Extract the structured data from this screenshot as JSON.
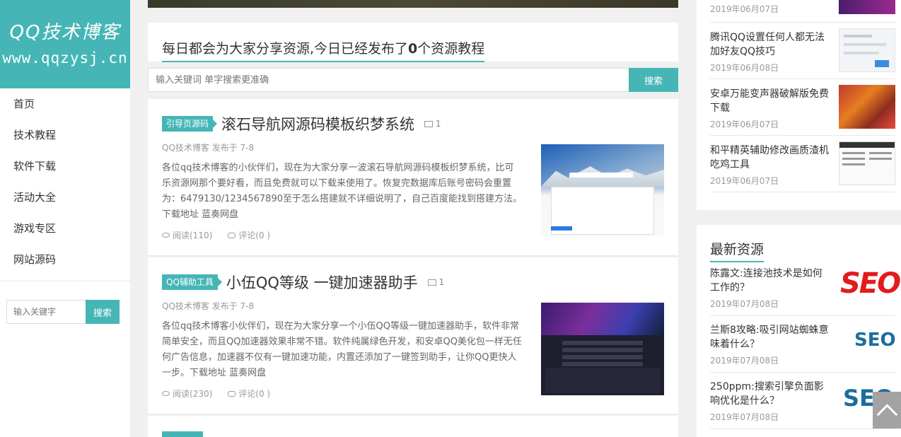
{
  "logo": {
    "title": "QQ技术博客",
    "url": "www.qqzysj.cn"
  },
  "nav": [
    "首页",
    "技术教程",
    "软件下载",
    "活动大全",
    "游戏专区",
    "网站源码"
  ],
  "side_search": {
    "placeholder": "输入关键字",
    "button": "搜索"
  },
  "announce": {
    "prefix": "每日都会为大家分享资源,今日已经发布了",
    "count": "0",
    "suffix": "个资源教程"
  },
  "main_search": {
    "placeholder": "输入关键词 单字搜索更准确",
    "button": "搜索"
  },
  "posts": [
    {
      "category": "引导页源码",
      "title": "滚石导航网源码模板织梦系统",
      "pics": "1",
      "meta": "QQ技术博客 发布于 7-8",
      "excerpt": "各位qq技术博客的小伙伴们，现在为大家分享一波滚石导航网源码模板织梦系统，比可乐资源网那个要好看，而且免费就可以下载来使用了。恢复完数据库后账号密码会重置为：6479130/1234567890至于怎么搭建就不详细说明了，自己百度能找到搭建方法。下载地址 蓝奏网盘",
      "views": "阅读(110)",
      "comments": "评论(0 )"
    },
    {
      "category": "QQ辅助工具",
      "title": "小伍QQ等级 一键加速器助手",
      "pics": "1",
      "meta": "QQ技术博客 发布于 7-8",
      "excerpt": "各位qq技术博客小伙伴们，现在为大家分享一个小伍QQ等级一键加速器助手，软件非常简单安全，而且QQ加速器效果非常不错。软件纯属绿色开发，和安卓QQ美化包一样无任何广告信息，加速器不仅有一键加速功能，内置还添加了一键签到助手，让你QQ更快人一步。下载地址 蓝奏网盘",
      "views": "阅读(230)",
      "comments": "评论(0 )"
    }
  ],
  "right_top": [
    {
      "title": "",
      "date": "2019年06月07日"
    },
    {
      "title": "腾讯QQ设置任何人都无法加好友QQ技巧",
      "date": "2019年06月08日"
    },
    {
      "title": "安卓万能变声器破解版免费下载",
      "date": "2019年06月07日"
    },
    {
      "title": "和平精英辅助修改画质渣机吃鸡工具",
      "date": "2019年06月07日"
    }
  ],
  "latest": {
    "title": "最新资源",
    "items": [
      {
        "title": "陈露文:连接池技术是如何工作的？",
        "date": "2019年07月08日",
        "thumb_text": "SEO"
      },
      {
        "title": "兰斯8攻略:吸引网站蜘蛛意味着什么？",
        "date": "2019年07月08日",
        "thumb_text": "SEO"
      },
      {
        "title": "250ppm:搜索引擎负面影响优化是什么？",
        "date": "2019年07月08日",
        "thumb_text": "SEO"
      }
    ]
  },
  "colors": {
    "accent": "#45b6b5",
    "background": "#f0f0f0"
  }
}
